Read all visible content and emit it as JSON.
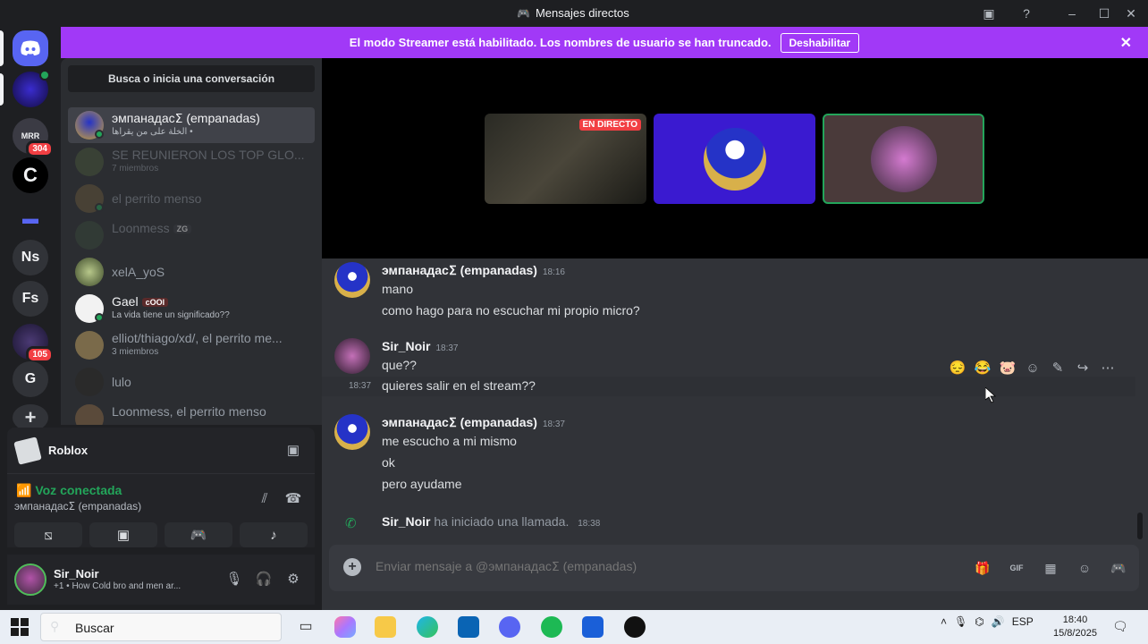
{
  "window": {
    "title": "Mensajes directos"
  },
  "servers": [
    {
      "label": "",
      "icon": "discord-home-icon"
    },
    {
      "label": "",
      "icon": "avatar"
    },
    {
      "label": "MRR",
      "badge": "304"
    },
    {
      "label": "C",
      "icon": "c-logo-icon"
    },
    {
      "label": "",
      "icon": "folder-icon"
    },
    {
      "label": "Ns"
    },
    {
      "label": "Fs"
    },
    {
      "label": "",
      "badge": "105"
    },
    {
      "label": "G"
    },
    {
      "label": "",
      "icon": "add-server-icon"
    }
  ],
  "banner": {
    "text": "El modo Streamer está habilitado. Los nombres de usuario se han truncado.",
    "button": "Deshabilitar"
  },
  "sidebar": {
    "search_label": "Busca o inicia una conversación",
    "dms": [
      {
        "name": "эмпанадасⵉ (empanadas)",
        "sub": "الخلة على من يقرأها •",
        "active": true
      },
      {
        "name": "SE REUNIERON LOS TOP GLO...",
        "sub": "7 miembros",
        "dim": true
      },
      {
        "name": "el perrito menso",
        "sub": "",
        "dim": true
      },
      {
        "name": "Loonmess",
        "sub": "",
        "tag": "ZG",
        "dim": true
      },
      {
        "name": "xelA_yoS",
        "sub": ""
      },
      {
        "name": "Gael",
        "sub": "La vida tiene un significado??",
        "tag": "cOOl",
        "bright": true
      },
      {
        "name": "elliot/thiago/xd/, el perrito me...",
        "sub": "3 miembros"
      },
      {
        "name": "lulo",
        "sub": ""
      },
      {
        "name": "Loonmess, el perrito menso",
        "sub": ""
      }
    ]
  },
  "voice": {
    "activity": "Roblox",
    "status": "Voz conectada",
    "target": "эмпанадасⵉ (empanadas)"
  },
  "user": {
    "name": "Sir_Noir",
    "status": "+1 • How Cold bro and men ar..."
  },
  "call": {
    "live_label": "EN DIRECTO"
  },
  "messages": [
    {
      "author": "эмпанадасⵉ (empanadas)",
      "time": "18:16",
      "lines": [
        "mano",
        "como hago para no escuchar mi propio micro?"
      ]
    },
    {
      "author": "Sir_Noir",
      "time": "18:37",
      "lines": [
        "que??"
      ],
      "followup_time": "18:37",
      "followup": "quieres salir en el stream??"
    },
    {
      "author": "эмпанадасⵉ (empanadas)",
      "time": "18:37",
      "lines": [
        "me escucho a mi mismo",
        "ok",
        "pero ayudame"
      ]
    },
    {
      "author": "Sir_Noir",
      "system": "ha iniciado una llamada.",
      "time": "18:38"
    }
  ],
  "composer": {
    "placeholder": "Enviar mensaje a @эмпанадасⵉ (empanadas)"
  },
  "taskbar": {
    "search": "Buscar",
    "lang": "ESP",
    "time": "18:40",
    "date": "15/8/2025"
  },
  "colors": {
    "banner": "#a139f7",
    "online": "#23a55a",
    "live": "#f23f43"
  }
}
